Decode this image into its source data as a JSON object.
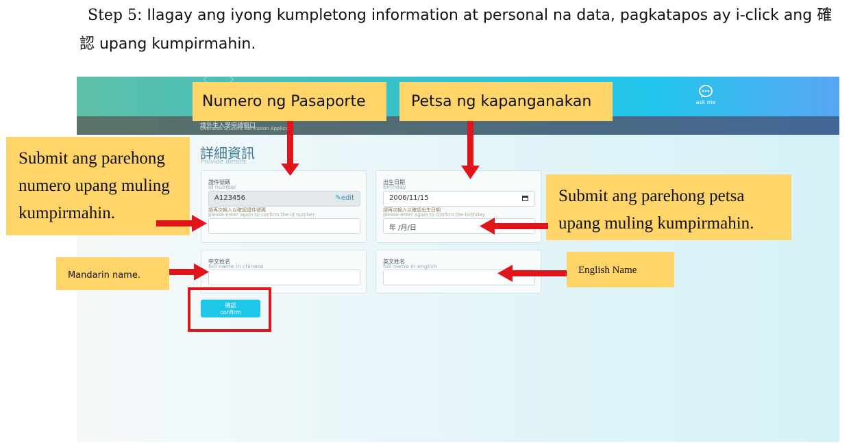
{
  "instruction": {
    "step_label": "Step 5",
    "line1_rest": ": Ilagay ang iyong kumpletong information at personal na data, pagkatapos ay i-click ang 確",
    "line2": "認 upang kumpirmahin."
  },
  "app": {
    "site_title_zh": "境外生入學申請窗口",
    "site_title_en": "Overseas Student Admission Applicat",
    "ask_me_label": "ask me",
    "page_title": "詳細資訊",
    "page_subtitle": "Provide details"
  },
  "form": {
    "id_number": {
      "label_zh": "證件號碼",
      "label_en": "id number",
      "value": "A123456",
      "edit_label": "edit",
      "confirm_hint_zh": "請再次輸入以確認證件號碼",
      "confirm_hint_en": "please enter again to confirm the id number",
      "confirm_value": ""
    },
    "birthday": {
      "label_zh": "出生日期",
      "label_en": "birthday",
      "value": "2006/11/15",
      "confirm_hint_zh": "請再次輸入以確認出生日期",
      "confirm_hint_en": "please enter again to confirm the birthday",
      "confirm_placeholder": "年 /月/日"
    },
    "chinese_name": {
      "label_zh": "中文姓名",
      "label_en": "full name in chinese",
      "value": ""
    },
    "english_name": {
      "label_zh": "英文姓名",
      "label_en": "full name in english",
      "value": ""
    },
    "confirm_button": {
      "label_zh": "確認",
      "label_en": "confirm"
    }
  },
  "callouts": {
    "passport": "Numero ng Pasaporte",
    "birthdate": "Petsa ng kapanganakan",
    "resubmit_number": [
      "Submit ang parehong",
      "numero upang muling",
      "kumpirmahin."
    ],
    "resubmit_date": [
      "Submit ang parehong petsa",
      "upang muling kumpirmahin."
    ],
    "mandarin": "Mandarin name.",
    "english": "English Name"
  },
  "colors": {
    "callout_bg": "#ffd56a",
    "arrow": "#e0151b",
    "confirm_button": "#1ec6ea"
  }
}
